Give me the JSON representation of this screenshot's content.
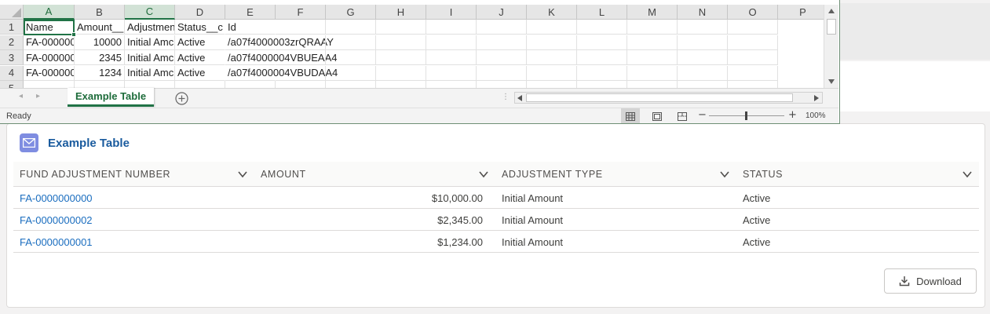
{
  "excel": {
    "column_headers": [
      "A",
      "B",
      "C",
      "D",
      "E",
      "F",
      "G",
      "H",
      "I",
      "J",
      "K",
      "L",
      "M",
      "N",
      "O",
      "P"
    ],
    "row_headers": [
      "1",
      "2",
      "3",
      "4",
      "5"
    ],
    "rows": [
      [
        "Name",
        "Amount__",
        "Adjustmen",
        "Status__c",
        "Id"
      ],
      [
        "FA-000000",
        "10000",
        "Initial Amc",
        "Active",
        "/a07f4000003zrQRAAY"
      ],
      [
        "FA-000000",
        "2345",
        "Initial Amc",
        "Active",
        "/a07f4000004VBUEAA4"
      ],
      [
        "FA-000000",
        "1234",
        "Initial Amc",
        "Active",
        "/a07f4000004VBUDAA4"
      ]
    ],
    "sheet_tab": "Example Table",
    "status_text": "Ready",
    "zoom": "100%"
  },
  "card": {
    "title": "Example Table",
    "columns": [
      "FUND ADJUSTMENT NUMBER",
      "AMOUNT",
      "ADJUSTMENT TYPE",
      "STATUS"
    ],
    "rows": [
      [
        "FA-0000000000",
        "$10,000.00",
        "Initial Amount",
        "Active"
      ],
      [
        "FA-0000000002",
        "$2,345.00",
        "Initial Amount",
        "Active"
      ],
      [
        "FA-0000000001",
        "$1,234.00",
        "Initial Amount",
        "Active"
      ]
    ],
    "download_label": "Download"
  },
  "colors": {
    "excel_green": "#217346",
    "link_blue": "#1a6dbf",
    "card_icon": "#7f8de1"
  },
  "icons": [
    "email-icon",
    "chevron-down-icon",
    "download-icon",
    "add-sheet-icon",
    "normal-view-icon",
    "page-layout-icon",
    "page-break-icon"
  ]
}
